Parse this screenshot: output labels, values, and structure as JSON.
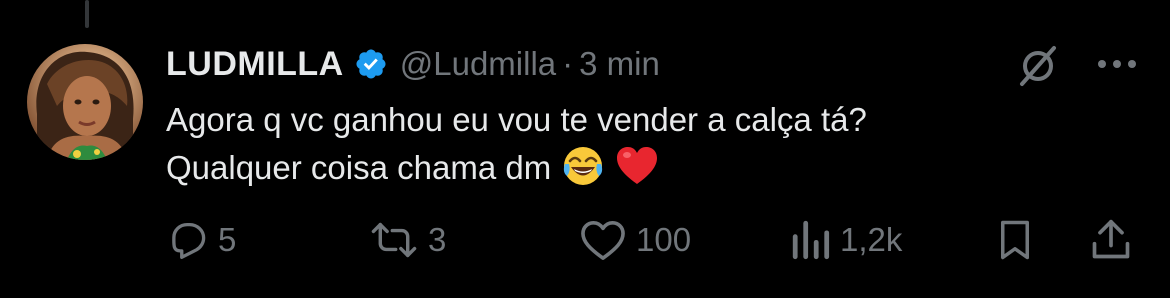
{
  "tweet": {
    "author": {
      "display_name": "LUDMILLA",
      "handle": "@Ludmilla",
      "separator": "·",
      "timestamp": "3 min",
      "verified": true,
      "verified_color": "#1d9bf0"
    },
    "text_lines": [
      "Agora q vc ganhou eu vou te vender a calça tá?",
      "Qualquer coisa chama dm"
    ],
    "emojis": [
      "face-with-tears-of-joy",
      "red-heart"
    ],
    "icons": {
      "grok": "grok-icon",
      "more": "more-horizontal-icon"
    }
  },
  "actions": {
    "reply": {
      "icon": "reply-icon",
      "count": "5"
    },
    "repost": {
      "icon": "repost-icon",
      "count": "3"
    },
    "like": {
      "icon": "heart-icon",
      "count": "100"
    },
    "views": {
      "icon": "views-icon",
      "count": "1,2k"
    },
    "bookmark": {
      "icon": "bookmark-icon"
    },
    "share": {
      "icon": "share-icon"
    }
  },
  "colors": {
    "background": "#000000",
    "text_primary": "#e7e9ea",
    "text_secondary": "#71767b",
    "thread_line": "#333639",
    "verified_blue": "#1d9bf0",
    "heart_red": "#e0245e"
  }
}
